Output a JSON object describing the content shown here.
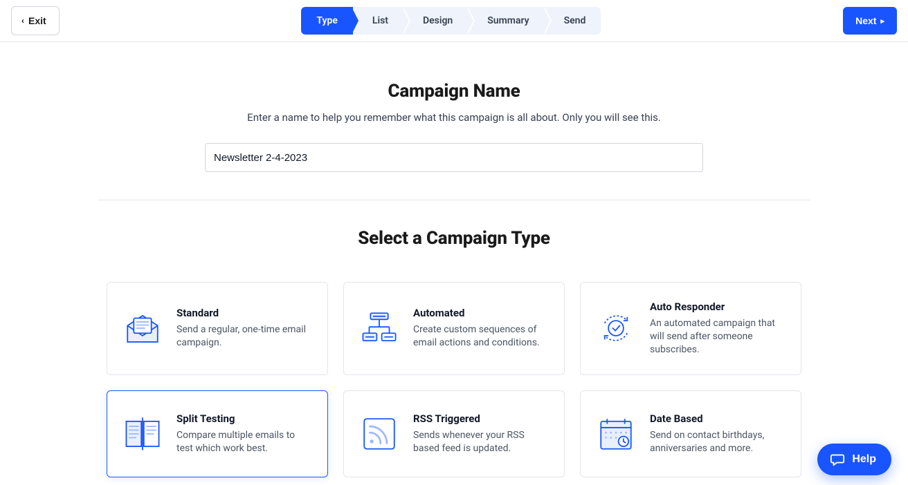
{
  "header": {
    "exit_label": "Exit",
    "next_label": "Next",
    "steps": [
      {
        "label": "Type",
        "active": true
      },
      {
        "label": "List",
        "active": false
      },
      {
        "label": "Design",
        "active": false
      },
      {
        "label": "Summary",
        "active": false
      },
      {
        "label": "Send",
        "active": false
      }
    ]
  },
  "campaign_name": {
    "title": "Campaign Name",
    "subtitle": "Enter a name to help you remember what this campaign is all about. Only you will see this.",
    "value": "Newsletter 2-4-2023"
  },
  "type_section": {
    "title": "Select a Campaign Type",
    "options": [
      {
        "id": "standard",
        "title": "Standard",
        "desc": "Send a regular, one-time email campaign.",
        "icon": "envelope-icon",
        "selected": false
      },
      {
        "id": "automated",
        "title": "Automated",
        "desc": "Create custom sequences of email actions and conditions.",
        "icon": "flow-icon",
        "selected": false
      },
      {
        "id": "auto-responder",
        "title": "Auto Responder",
        "desc": "An automated campaign that will send after someone subscribes.",
        "icon": "responder-icon",
        "selected": false
      },
      {
        "id": "split-testing",
        "title": "Split Testing",
        "desc": "Compare multiple emails to test which work best.",
        "icon": "split-icon",
        "selected": true
      },
      {
        "id": "rss-triggered",
        "title": "RSS Triggered",
        "desc": "Sends whenever your RSS based feed is updated.",
        "icon": "rss-icon",
        "selected": false
      },
      {
        "id": "date-based",
        "title": "Date Based",
        "desc": "Send on contact birthdays, anniversaries and more.",
        "icon": "calendar-icon",
        "selected": false
      }
    ]
  },
  "help": {
    "label": "Help"
  },
  "colors": {
    "accent": "#1955ff",
    "step_bg": "#eff3fb",
    "border": "#e5e7eb"
  }
}
